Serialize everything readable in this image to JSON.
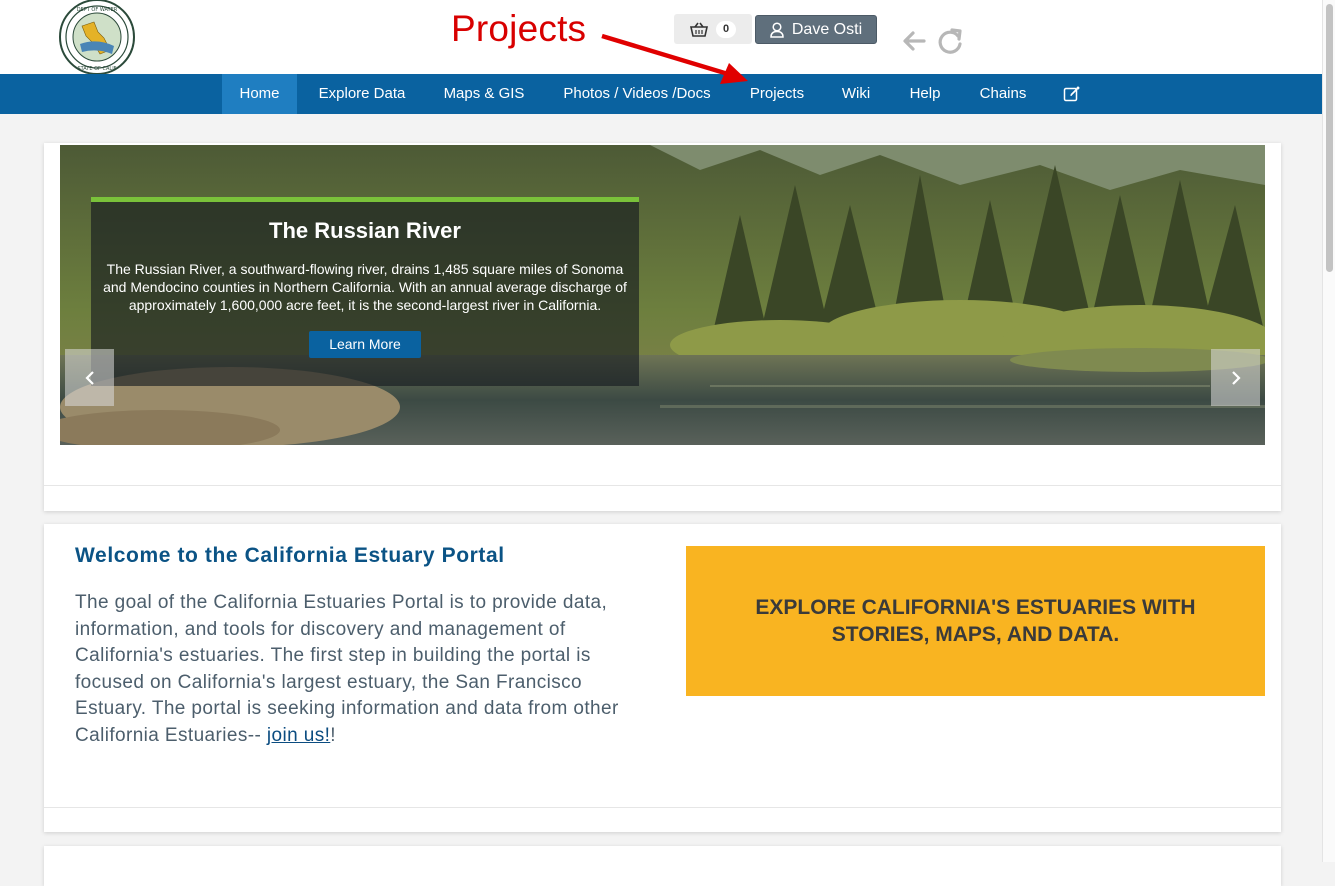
{
  "annotation": {
    "label": "Projects"
  },
  "header": {
    "logo_alt": "Department of Water Resources - State of California",
    "cart_count": "0",
    "user_name": "Dave Osti"
  },
  "nav": {
    "items": [
      {
        "label": "Home"
      },
      {
        "label": "Explore Data"
      },
      {
        "label": "Maps & GIS"
      },
      {
        "label": "Photos / Videos /Docs"
      },
      {
        "label": "Projects"
      },
      {
        "label": "Wiki"
      },
      {
        "label": "Help"
      },
      {
        "label": "Chains"
      }
    ],
    "active": "Home"
  },
  "hero": {
    "title": "The Russian River",
    "text": "The Russian River, a southward-flowing river, drains 1,485 square miles of Sonoma and Mendocino counties in Northern California. With an annual average discharge of approximately 1,600,000 acre feet, it is the second-largest river in California.",
    "button": "Learn More"
  },
  "welcome": {
    "title": "Welcome to the California Estuary Portal",
    "text": "The goal of the California Estuaries Portal is to provide data, information, and tools for discovery and management of California's estuaries. The first step in building the portal is focused on California's largest estuary, the San Francisco Estuary. The portal is seeking information and data from other California Estuaries--",
    "link": "join us!",
    "after_link": "!"
  },
  "explore": {
    "text": "EXPLORE CALIFORNIA'S ESTUARIES WITH STORIES, MAPS, AND DATA."
  },
  "colors": {
    "nav_bg": "#0a62a0",
    "accent_yellow": "#f9b421",
    "annotation_red": "#d80000",
    "caption_border": "#7ac13a"
  }
}
